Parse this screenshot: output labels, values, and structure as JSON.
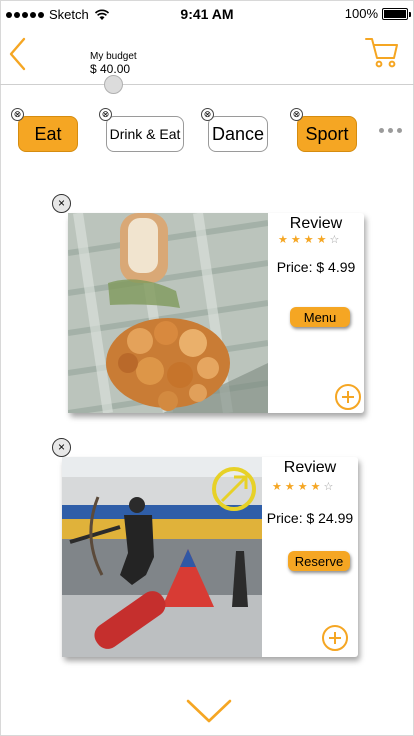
{
  "status_bar": {
    "carrier": "Sketch",
    "time": "9:41 AM",
    "battery_percent": "100%"
  },
  "header": {
    "budget_label": "My budget",
    "budget_value": "$ 40.00",
    "icons": {
      "back": "chevron-left-icon",
      "cart": "cart-icon"
    }
  },
  "categories": [
    {
      "label": "Eat",
      "active": true,
      "remove": "⊗"
    },
    {
      "label": "Drink & Eat",
      "active": false,
      "remove": "⊗"
    },
    {
      "label": "Dance",
      "active": false,
      "remove": "⊗"
    },
    {
      "label": "Sport",
      "active": true,
      "remove": "⊗"
    }
  ],
  "cards": [
    {
      "review_label": "Review",
      "rating": 4,
      "rating_max": 5,
      "price": "Price: $ 4.99",
      "action_label": "Menu",
      "remove": "×"
    },
    {
      "review_label": "Review",
      "rating": 4,
      "rating_max": 5,
      "price": "Price: $ 24.99",
      "action_label": "Reserve",
      "remove": "×"
    }
  ],
  "theme": {
    "accent": "#f5a623",
    "inactive_star": "#9b9b9b",
    "divider": "#cfcfcf"
  }
}
